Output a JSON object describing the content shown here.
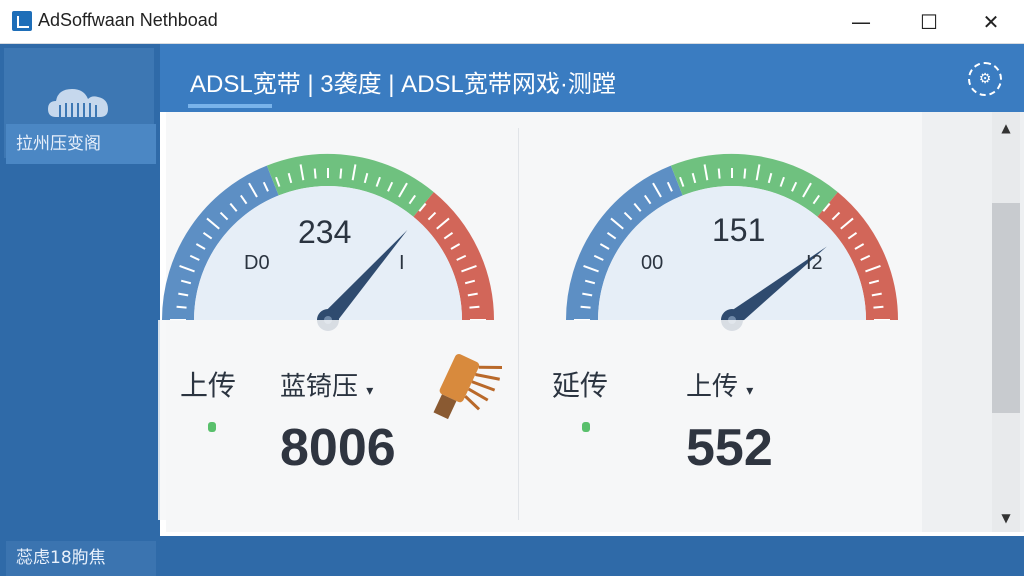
{
  "window": {
    "title": "AdSoffwaan Nethboad",
    "minimize_glyph": "—",
    "maximize_glyph": "☐",
    "close_glyph": "✕"
  },
  "sidebar": {
    "icon": "cloud-icon",
    "item_label": "拉州压变阁",
    "footer_label": "蕊虑18朐焦"
  },
  "header": {
    "title": "ADSL宽带 | 3袭度 | ADSL宽带网戏·测蹚",
    "settings_icon": "settings-icon"
  },
  "gauges": [
    {
      "value_text": "234",
      "min_label": "D0",
      "max_label": "I",
      "needle_fraction": 0.73
    },
    {
      "value_text": "151",
      "min_label": "00",
      "max_label": "I2",
      "needle_fraction": 0.79
    }
  ],
  "metrics_left": {
    "label": "上传",
    "select_label": "蓝锜压",
    "select_arrow": "▾",
    "value": "8006"
  },
  "metrics_right": {
    "label": "延传",
    "select_label": "上传",
    "select_arrow": "▾",
    "value": "552"
  },
  "scrollbar": {
    "up": "▲",
    "down": "▼",
    "level": 0.42
  },
  "colors": {
    "accent": "#3a7cc1",
    "sidebar": "#2f6aa8",
    "gauge_green": "#6fc17f",
    "gauge_red": "#d26659",
    "gauge_blue": "#5d8fc4",
    "needle": "#2f4b6f"
  }
}
